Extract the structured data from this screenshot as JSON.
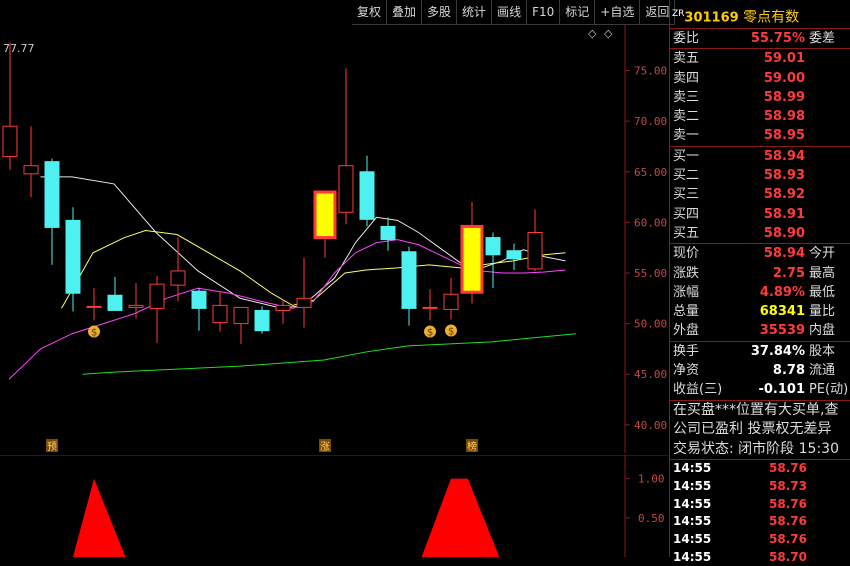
{
  "toolbar": {
    "buttons": [
      "复权",
      "叠加",
      "多股",
      "统计",
      "画线",
      "F10",
      "标记",
      "+自选",
      "返回"
    ]
  },
  "stock": {
    "tag": "ZR",
    "code": "301169",
    "name": "零点有数"
  },
  "order_ratio": {
    "label": "委比",
    "value": "55.75%",
    "label2": "委差"
  },
  "asks": [
    {
      "label": "卖五",
      "price": "59.01"
    },
    {
      "label": "卖四",
      "price": "59.00"
    },
    {
      "label": "卖三",
      "price": "58.99"
    },
    {
      "label": "卖二",
      "price": "58.98"
    },
    {
      "label": "卖一",
      "price": "58.95"
    }
  ],
  "bids": [
    {
      "label": "买一",
      "price": "58.94"
    },
    {
      "label": "买二",
      "price": "58.93"
    },
    {
      "label": "买三",
      "price": "58.92"
    },
    {
      "label": "买四",
      "price": "58.91"
    },
    {
      "label": "买五",
      "price": "58.90"
    }
  ],
  "quote": [
    {
      "label": "现价",
      "value": "58.94",
      "label2": "今开"
    },
    {
      "label": "涨跌",
      "value": "2.75",
      "label2": "最高"
    },
    {
      "label": "涨幅",
      "value": "4.89%",
      "label2": "最低"
    },
    {
      "label": "总量",
      "value": "68341",
      "label2": "量比"
    },
    {
      "label": "外盘",
      "value": "35539",
      "label2": "内盘"
    }
  ],
  "fundamentals": [
    {
      "label": "换手",
      "value": "37.84%",
      "label2": "股本"
    },
    {
      "label": "净资",
      "value": "8.78",
      "label2": "流通"
    },
    {
      "label": "收益(三)",
      "value": "-0.101",
      "label2": "PE(动)"
    }
  ],
  "messages": [
    "在买盘***位置有大买单,查",
    "公司已盈利 投票权无差异"
  ],
  "trade_status": {
    "label": "交易状态: 闭市阶段",
    "time": "15:30"
  },
  "ticks": [
    {
      "time": "14:55",
      "price": "58.76"
    },
    {
      "time": "14:55",
      "price": "58.73"
    },
    {
      "time": "14:55",
      "price": "58.76"
    },
    {
      "time": "14:55",
      "price": "58.76"
    },
    {
      "time": "14:55",
      "price": "58.76"
    },
    {
      "time": "14:55",
      "price": "58.70"
    }
  ],
  "chart_data": {
    "type": "candlestick",
    "ylim": [
      38.5,
      79.5
    ],
    "y_ticks": [
      "75.00",
      "70.00",
      "65.00",
      "60.00",
      "55.00",
      "50.00",
      "45.00",
      "40.00"
    ],
    "high_label": "77.77",
    "candles": [
      {
        "o": 66.5,
        "h": 77.77,
        "l": 65.2,
        "c": 69.5
      },
      {
        "o": 64.8,
        "h": 69.5,
        "l": 62.5,
        "c": 65.6
      },
      {
        "o": 66.0,
        "h": 66.3,
        "l": 55.8,
        "c": 59.5
      },
      {
        "o": 60.2,
        "h": 61.5,
        "l": 51.2,
        "c": 53.0
      },
      {
        "o": 51.6,
        "h": 53.5,
        "l": 50.3,
        "c": 51.7
      },
      {
        "o": 52.8,
        "h": 54.6,
        "l": 51.3,
        "c": 51.3
      },
      {
        "o": 51.6,
        "h": 54.0,
        "l": 50.5,
        "c": 51.8
      },
      {
        "o": 51.5,
        "h": 54.7,
        "l": 48.1,
        "c": 53.9
      },
      {
        "o": 53.8,
        "h": 58.5,
        "l": 52.2,
        "c": 55.2
      },
      {
        "o": 53.2,
        "h": 53.5,
        "l": 49.3,
        "c": 51.5
      },
      {
        "o": 50.1,
        "h": 53.2,
        "l": 49.2,
        "c": 51.8
      },
      {
        "o": 50.0,
        "h": 51.0,
        "l": 48.0,
        "c": 51.6
      },
      {
        "o": 51.3,
        "h": 51.7,
        "l": 49.0,
        "c": 49.3
      },
      {
        "o": 51.3,
        "h": 52.4,
        "l": 50.0,
        "c": 51.8
      },
      {
        "o": 51.6,
        "h": 56.5,
        "l": 49.6,
        "c": 52.5
      },
      {
        "o": 58.5,
        "h": 63.0,
        "l": 56.5,
        "c": 63.0
      },
      {
        "o": 61.0,
        "h": 75.2,
        "l": 59.8,
        "c": 65.6
      },
      {
        "o": 65.0,
        "h": 66.6,
        "l": 59.6,
        "c": 60.3
      },
      {
        "o": 59.6,
        "h": 60.5,
        "l": 57.2,
        "c": 58.3
      },
      {
        "o": 57.1,
        "h": 57.6,
        "l": 49.8,
        "c": 51.5
      },
      {
        "o": 51.6,
        "h": 53.4,
        "l": 50.3,
        "c": 51.6
      },
      {
        "o": 51.4,
        "h": 54.5,
        "l": 50.4,
        "c": 52.9
      },
      {
        "o": 53.1,
        "h": 62.0,
        "l": 52.0,
        "c": 59.6
      },
      {
        "o": 58.5,
        "h": 59.0,
        "l": 53.5,
        "c": 56.8
      },
      {
        "o": 57.2,
        "h": 57.9,
        "l": 55.3,
        "c": 56.4
      },
      {
        "o": 55.4,
        "h": 61.3,
        "l": 55.2,
        "c": 59.0
      }
    ],
    "ma_white": [
      [
        3,
        64.5
      ],
      [
        6,
        64.5
      ],
      [
        10,
        63.8
      ],
      [
        14,
        59.0
      ],
      [
        18,
        55.2
      ],
      [
        22,
        52.5
      ],
      [
        26,
        51.5
      ],
      [
        28,
        51.8
      ],
      [
        31,
        54.5
      ],
      [
        33,
        58.0
      ],
      [
        35,
        60.5
      ],
      [
        37,
        60.2
      ],
      [
        39,
        59.0
      ],
      [
        41,
        57.5
      ],
      [
        43,
        56.0
      ],
      [
        45,
        55.5
      ],
      [
        47,
        56.2
      ],
      [
        49,
        57.3
      ],
      [
        51,
        56.6
      ],
      [
        53,
        56.2
      ]
    ],
    "ma_yellow": [
      [
        5,
        51.5
      ],
      [
        8,
        57.0
      ],
      [
        11,
        58.5
      ],
      [
        13,
        59.2
      ],
      [
        16,
        58.8
      ],
      [
        19,
        57.0
      ],
      [
        22,
        55.2
      ],
      [
        25,
        53.0
      ],
      [
        27,
        51.8
      ],
      [
        29,
        52.3
      ],
      [
        32,
        55.0
      ],
      [
        34,
        55.3
      ],
      [
        37,
        55.5
      ],
      [
        40,
        55.8
      ],
      [
        43,
        55.5
      ],
      [
        45,
        55.8
      ],
      [
        48,
        56.2
      ],
      [
        51,
        56.8
      ],
      [
        53,
        57.0
      ]
    ],
    "ma_magenta": [
      [
        0,
        44.5
      ],
      [
        3,
        47.5
      ],
      [
        6,
        49.0
      ],
      [
        9,
        50.0
      ],
      [
        12,
        51.0
      ],
      [
        15,
        52.5
      ],
      [
        18,
        53.5
      ],
      [
        21,
        53.0
      ],
      [
        24,
        52.2
      ],
      [
        27,
        51.5
      ],
      [
        29,
        52.2
      ],
      [
        31,
        55.0
      ],
      [
        33,
        57.0
      ],
      [
        35,
        58.0
      ],
      [
        37,
        58.3
      ],
      [
        39,
        57.8
      ],
      [
        41,
        56.8
      ],
      [
        43,
        55.8
      ],
      [
        45,
        55.2
      ],
      [
        47,
        55.0
      ],
      [
        49,
        55.0
      ],
      [
        51,
        55.1
      ],
      [
        53,
        55.3
      ]
    ],
    "ma_green": [
      [
        7,
        45.0
      ],
      [
        10,
        45.2
      ],
      [
        14,
        45.4
      ],
      [
        18,
        45.6
      ],
      [
        22,
        45.8
      ],
      [
        26,
        46.1
      ],
      [
        30,
        46.4
      ],
      [
        34,
        47.2
      ],
      [
        38,
        47.8
      ],
      [
        42,
        48.0
      ],
      [
        46,
        48.2
      ],
      [
        50,
        48.6
      ],
      [
        54,
        49.0
      ]
    ],
    "markers": [
      {
        "i": 4,
        "kind": "money",
        "text": "$"
      },
      {
        "i": 20,
        "kind": "money",
        "text": "$"
      },
      {
        "i": 21,
        "kind": "money",
        "text": "$"
      }
    ],
    "events": [
      {
        "i": 2,
        "text": "预"
      },
      {
        "i": 15,
        "text": "涨"
      },
      {
        "i": 22,
        "text": "榜"
      }
    ],
    "indicator": {
      "ylim": [
        0,
        1.2
      ],
      "y_ticks": [
        "1.00",
        "0.50"
      ],
      "triangles": [
        {
          "from": 3,
          "peak": 4.5,
          "to": 5.5
        }
      ],
      "trapezoids": [
        {
          "from": 19.6,
          "top1": 21.0,
          "top2": 21.8,
          "to": 23.3
        }
      ]
    }
  }
}
